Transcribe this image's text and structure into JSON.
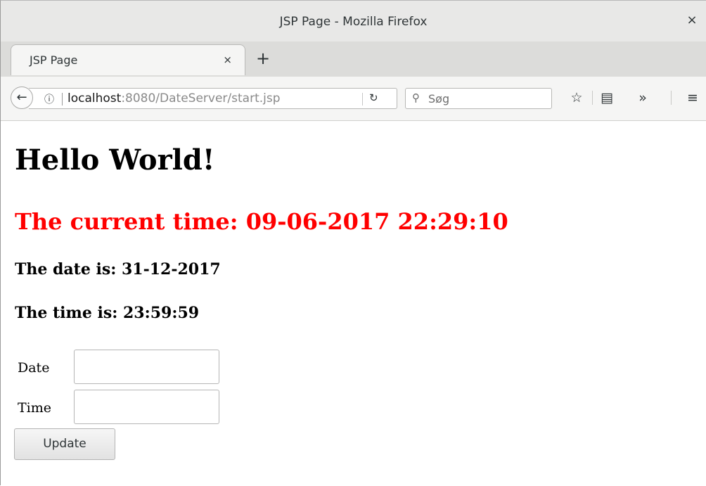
{
  "window": {
    "title": "JSP Page - Mozilla Firefox",
    "close_glyph": "×"
  },
  "tabs": [
    {
      "label": "JSP Page",
      "close_glyph": "×",
      "active": true
    }
  ],
  "new_tab_glyph": "+",
  "navbar": {
    "back_glyph": "←",
    "info_glyph": "ⓘ",
    "url_host": "localhost",
    "url_rest": ":8080/DateServer/start.jsp",
    "reload_glyph": "↻",
    "search_placeholder": "Søg",
    "search_glyph": "⚲",
    "bookmark_glyph": "☆",
    "reader_glyph": "▤",
    "overflow_glyph": "»",
    "menu_glyph": "≡"
  },
  "page": {
    "heading": "Hello World!",
    "current_time": "The current time: 09-06-2017 22:29:10",
    "date_line": "The date is: 31-12-2017",
    "time_line": "The time is: 23:59:59",
    "form": {
      "date_label": "Date",
      "date_value": "",
      "time_label": "Time",
      "time_value": "",
      "submit_label": "Update"
    }
  },
  "colors": {
    "current_time": "#ff0000",
    "chrome_bg": "#e8e8e7"
  }
}
